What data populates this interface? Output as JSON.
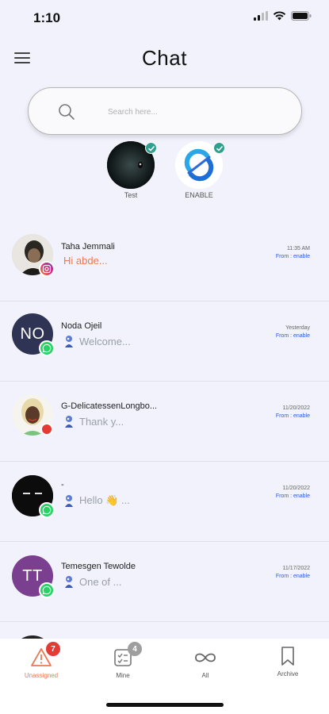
{
  "status": {
    "time": "1:10"
  },
  "header": {
    "title": "Chat"
  },
  "search": {
    "placeholder": "Search here..."
  },
  "channels": [
    {
      "label": "Test"
    },
    {
      "label": "ENABLE"
    }
  ],
  "chats": [
    {
      "name": "Taha Jemmali",
      "preview": "Hi abde...",
      "time": "11:35 AM",
      "from": "From : enable",
      "channel": "instagram",
      "initials": ""
    },
    {
      "name": "Noda Ojeil",
      "preview": "Welcome...",
      "time": "Yesterday",
      "from": "From : enable",
      "channel": "whatsapp",
      "initials": "NO"
    },
    {
      "name": "G-DelicatessenLongbo...",
      "preview": "Thank y...",
      "time": "11/20/2022",
      "from": "From : enable",
      "channel": "other",
      "initials": ""
    },
    {
      "name": "-",
      "preview": "Hello 👋 ...",
      "time": "11/20/2022",
      "from": "From : enable",
      "channel": "whatsapp",
      "initials": ""
    },
    {
      "name": "Temesgen Tewolde",
      "preview": "One of ...",
      "time": "11/17/2022",
      "from": "From : enable",
      "channel": "whatsapp",
      "initials": "TT"
    }
  ],
  "nav": [
    {
      "label": "Unassigned",
      "count": "7"
    },
    {
      "label": "Mine",
      "count": "4"
    },
    {
      "label": "All"
    },
    {
      "label": "Archive"
    }
  ],
  "colors": {
    "accent": "#e97a54",
    "link": "#2d5ce6",
    "badge_red": "#e53935",
    "badge_grey": "#9e9e9e",
    "whatsapp": "#25d366"
  }
}
